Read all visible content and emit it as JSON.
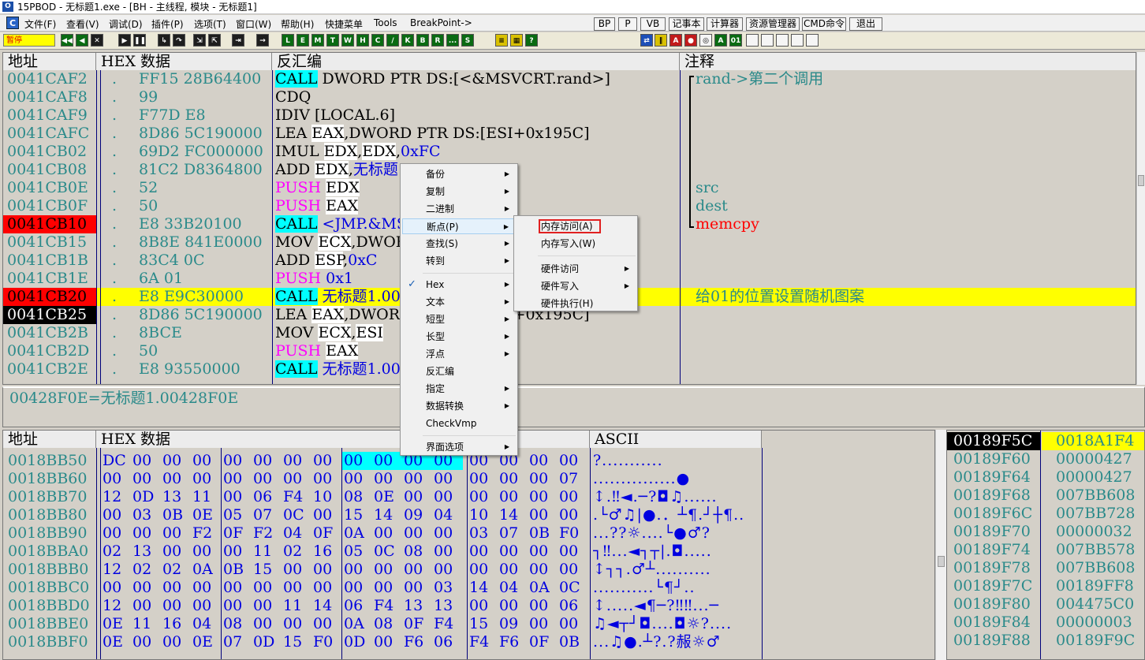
{
  "window": {
    "title": "15PBOD  - 无标题1.exe - [BH - 主线程, 模块 - 无标题1]"
  },
  "menu": [
    "文件(F)",
    "查看(V)",
    "调试(D)",
    "插件(P)",
    "选项(T)",
    "窗口(W)",
    "帮助(H)",
    "快捷菜单",
    "Tools",
    "BreakPoint->"
  ],
  "quick_buttons": [
    "BP",
    "P",
    "VB",
    "记事本",
    "计算器",
    "资源管理器",
    "CMD命令",
    "退出"
  ],
  "status_pause": "暂停",
  "toolbar_letters": [
    "L",
    "E",
    "M",
    "T",
    "W",
    "H",
    "C",
    "/",
    "K",
    "B",
    "R",
    "...",
    "S"
  ],
  "cpu": {
    "headers": {
      "addr": "地址",
      "hex": "HEX 数据",
      "dis": "反汇编",
      "cmt": "注释"
    },
    "rows": [
      {
        "addr": "0041CAF2",
        "mark": ".",
        "hex": "FF15 28B64400",
        "dis": [
          [
            "CALL",
            "cyan"
          ],
          [
            " DWORD PTR DS:[<&MSVCRT.rand>]",
            ""
          ]
        ],
        "cmt": [
          [
            "rand->第二个调用",
            "teal"
          ]
        ],
        "bracket": "top"
      },
      {
        "addr": "0041CAF8",
        "mark": ".",
        "hex": "99",
        "dis": [
          [
            "CDQ",
            ""
          ]
        ],
        "cmt": []
      },
      {
        "addr": "0041CAF9",
        "mark": ".",
        "hex": "F77D E8",
        "dis": [
          [
            "IDIV [LOCAL.6]",
            ""
          ]
        ],
        "cmt": []
      },
      {
        "addr": "0041CAFC",
        "mark": ".",
        "hex": "8D86 5C190000",
        "dis": [
          [
            "LEA ",
            ""
          ],
          [
            "EAX",
            "white"
          ],
          [
            ",DWORD PTR DS:[ESI+0x195C]",
            ""
          ]
        ],
        "cmt": []
      },
      {
        "addr": "0041CB02",
        "mark": ".",
        "hex": "69D2 FC000000",
        "dis": [
          [
            "IMUL ",
            ""
          ],
          [
            "EDX",
            "white"
          ],
          [
            ",",
            ""
          ],
          [
            "EDX",
            "white"
          ],
          [
            ",",
            ""
          ],
          [
            "0xFC",
            "blue"
          ]
        ],
        "cmt": []
      },
      {
        "addr": "0041CB08",
        "mark": ".",
        "hex": "81C2 D8364800",
        "dis": [
          [
            "ADD ",
            ""
          ],
          [
            "EDX",
            "white"
          ],
          [
            ",",
            ""
          ],
          [
            "无标题1.",
            "blue"
          ]
        ],
        "cmt": []
      },
      {
        "addr": "0041CB0E",
        "mark": ".",
        "hex": "52",
        "dis": [
          [
            "PUSH",
            "magenta"
          ],
          [
            " ",
            ""
          ],
          [
            "EDX",
            "white"
          ]
        ],
        "cmt": [
          [
            "src",
            "teal"
          ]
        ]
      },
      {
        "addr": "0041CB0F",
        "mark": ".",
        "hex": "50",
        "dis": [
          [
            "PUSH",
            "magenta"
          ],
          [
            " ",
            ""
          ],
          [
            "EAX",
            "white"
          ]
        ],
        "cmt": [
          [
            "dest",
            "teal"
          ]
        ]
      },
      {
        "addr": "0041CB10",
        "mark": ".",
        "hex": "E8 33B20100",
        "dis": [
          [
            "CALL",
            "cyan"
          ],
          [
            " <JMP.&MSVCRT.memcpy>",
            "blue"
          ]
        ],
        "cmt": [
          [
            "memcpy",
            "red"
          ]
        ],
        "addr_style": "red",
        "bracket": "bottom"
      },
      {
        "addr": "0041CB15",
        "mark": ".",
        "hex": "8B8E 841E0000",
        "dis": [
          [
            "MOV ",
            ""
          ],
          [
            "ECX",
            "white"
          ],
          [
            ",DWORD PTR DS:[ESI+0x1E84]",
            ""
          ]
        ],
        "cmt": []
      },
      {
        "addr": "0041CB1B",
        "mark": ".",
        "hex": "83C4 0C",
        "dis": [
          [
            "ADD ",
            ""
          ],
          [
            "ESP",
            "white"
          ],
          [
            ",",
            ""
          ],
          [
            "0xC",
            "blue"
          ]
        ],
        "cmt": []
      },
      {
        "addr": "0041CB1E",
        "mark": ".",
        "hex": "6A 01",
        "dis": [
          [
            "PUSH",
            "magenta"
          ],
          [
            " ",
            ""
          ],
          [
            "0x1",
            "blue"
          ]
        ],
        "cmt": []
      },
      {
        "addr": "0041CB20",
        "mark": ".",
        "hex": "E8 E9C30000",
        "dis": [
          [
            "CALL",
            "cyan"
          ],
          [
            " ",
            ""
          ],
          [
            "无标题1.0042",
            "blue"
          ]
        ],
        "cmt": [
          [
            "给01的位置设置随机图案",
            "teal"
          ]
        ],
        "addr_style": "red",
        "row_style": "yellow"
      },
      {
        "addr": "0041CB25",
        "mark": ".",
        "hex": "8D86 5C190000",
        "dis": [
          [
            "LEA ",
            ""
          ],
          [
            "EAX",
            "white"
          ],
          [
            ",DWORD PTR DS:[ESI+0x195C]",
            ""
          ]
        ],
        "cmt": [],
        "addr_style": "black"
      },
      {
        "addr": "0041CB2B",
        "mark": ".",
        "hex": "8BCE",
        "dis": [
          [
            "MOV ",
            ""
          ],
          [
            "ECX",
            "white"
          ],
          [
            ",",
            ""
          ],
          [
            "ESI",
            "white"
          ]
        ],
        "cmt": []
      },
      {
        "addr": "0041CB2D",
        "mark": ".",
        "hex": "50",
        "dis": [
          [
            "PUSH",
            "magenta"
          ],
          [
            " ",
            ""
          ],
          [
            "EAX",
            "white"
          ]
        ],
        "cmt": []
      },
      {
        "addr": "0041CB2E",
        "mark": ".",
        "hex": "E8 93550000",
        "dis": [
          [
            "CALL",
            "cyan"
          ],
          [
            " ",
            ""
          ],
          [
            "无标题1.0042",
            "blue"
          ]
        ],
        "cmt": []
      }
    ]
  },
  "info_line": "00428F0E=无标题1.00428F0E",
  "dump": {
    "headers": {
      "addr": "地址",
      "hex": "HEX 数据",
      "ascii": "ASCII"
    },
    "rows": [
      {
        "addr": "0018BB50",
        "bytes": [
          "DC",
          "00",
          "00",
          "00",
          "00",
          "00",
          "00",
          "00",
          "00",
          "00",
          "00",
          "00",
          "00",
          "00",
          "00",
          "00"
        ],
        "ascii": "?..........."
      },
      {
        "addr": "0018BB60",
        "bytes": [
          "00",
          "00",
          "00",
          "00",
          "00",
          "00",
          "00",
          "00",
          "00",
          "00",
          "00",
          "00",
          "00",
          "00",
          "00",
          "07"
        ],
        "ascii": "...............●"
      },
      {
        "addr": "0018BB70",
        "bytes": [
          "12",
          "0D",
          "13",
          "11",
          "00",
          "06",
          "F4",
          "10",
          "08",
          "0E",
          "00",
          "00",
          "00",
          "00",
          "00",
          "00"
        ],
        "ascii": "↕.‼◄.─?◘♫......"
      },
      {
        "addr": "0018BB80",
        "bytes": [
          "00",
          "03",
          "0B",
          "0E",
          "05",
          "07",
          "0C",
          "00",
          "15",
          "14",
          "09",
          "04",
          "10",
          "14",
          "00",
          "00"
        ],
        "ascii": ".└♂♫|●.．┴¶.┘┼¶.."
      },
      {
        "addr": "0018BB90",
        "bytes": [
          "00",
          "00",
          "00",
          "F2",
          "0F",
          "F2",
          "04",
          "0F",
          "0A",
          "00",
          "00",
          "00",
          "03",
          "07",
          "0B",
          "F0"
        ],
        "ascii": "...??☼....└●♂?"
      },
      {
        "addr": "0018BBA0",
        "bytes": [
          "02",
          "13",
          "00",
          "00",
          "00",
          "11",
          "02",
          "16",
          "05",
          "0C",
          "08",
          "00",
          "00",
          "00",
          "00",
          "00"
        ],
        "ascii": "┐‼...◄┐┬|.◘....."
      },
      {
        "addr": "0018BBB0",
        "bytes": [
          "12",
          "02",
          "02",
          "0A",
          "0B",
          "15",
          "00",
          "00",
          "00",
          "00",
          "00",
          "00",
          "00",
          "00",
          "00",
          "00"
        ],
        "ascii": "↕┐┐.♂┴.........."
      },
      {
        "addr": "0018BBC0",
        "bytes": [
          "00",
          "00",
          "00",
          "00",
          "00",
          "00",
          "00",
          "00",
          "00",
          "00",
          "00",
          "03",
          "14",
          "04",
          "0A",
          "0C"
        ],
        "ascii": "...........└¶┘.."
      },
      {
        "addr": "0018BBD0",
        "bytes": [
          "12",
          "00",
          "00",
          "00",
          "00",
          "00",
          "11",
          "14",
          "06",
          "F4",
          "13",
          "13",
          "00",
          "00",
          "00",
          "06"
        ],
        "ascii": "↕.....◄¶─?‼‼...─"
      },
      {
        "addr": "0018BBE0",
        "bytes": [
          "0E",
          "11",
          "16",
          "04",
          "08",
          "00",
          "00",
          "00",
          "0A",
          "08",
          "0F",
          "F4",
          "15",
          "09",
          "00",
          "00"
        ],
        "ascii": "♫◄┬┘◘....◘☼?...."
      },
      {
        "addr": "0018BBF0",
        "bytes": [
          "0E",
          "00",
          "00",
          "0E",
          "07",
          "0D",
          "15",
          "F0",
          "0D",
          "00",
          "F6",
          "06",
          "F4",
          "F6",
          "0F",
          "0B"
        ],
        "ascii": "...♫●.┴?.?赧☼♂"
      }
    ]
  },
  "stack": {
    "rows": [
      {
        "addr": "00189F5C",
        "val": "0018A1F4",
        "top": true
      },
      {
        "addr": "00189F60",
        "val": "00000427"
      },
      {
        "addr": "00189F64",
        "val": "00000427"
      },
      {
        "addr": "00189F68",
        "val": "007BB608"
      },
      {
        "addr": "00189F6C",
        "val": "007BB728"
      },
      {
        "addr": "00189F70",
        "val": "00000032"
      },
      {
        "addr": "00189F74",
        "val": "007BB578"
      },
      {
        "addr": "00189F78",
        "val": "007BB608"
      },
      {
        "addr": "00189F7C",
        "val": "00189FF8"
      },
      {
        "addr": "00189F80",
        "val": "004475C0"
      },
      {
        "addr": "00189F84",
        "val": "00000003"
      },
      {
        "addr": "00189F88",
        "val": "00189F9C"
      }
    ]
  },
  "context_menu": {
    "items": [
      {
        "label": "备份",
        "sub": true
      },
      {
        "label": "复制",
        "sub": true
      },
      {
        "label": "二进制",
        "sub": true
      },
      {
        "label": "断点(P)",
        "sub": true,
        "active": true
      },
      {
        "label": "查找(S)",
        "sub": true
      },
      {
        "label": "转到",
        "sub": true
      },
      {
        "sep": true
      },
      {
        "label": "Hex",
        "sub": true,
        "checked": true
      },
      {
        "label": "文本",
        "sub": true
      },
      {
        "label": "短型",
        "sub": true
      },
      {
        "label": "长型",
        "sub": true
      },
      {
        "label": "浮点",
        "sub": true
      },
      {
        "label": "反汇编",
        "sub": false
      },
      {
        "label": "指定",
        "sub": true
      },
      {
        "label": "数据转换",
        "sub": true
      },
      {
        "label": "CheckVmp",
        "sub": false
      },
      {
        "sep": true
      },
      {
        "label": "界面选项",
        "sub": true
      }
    ],
    "submenu": [
      {
        "label": "内存访问(A)",
        "boxed": true
      },
      {
        "label": "内存写入(W)"
      },
      {
        "sep": true
      },
      {
        "label": "硬件访问",
        "sub": true
      },
      {
        "label": "硬件写入",
        "sub": true
      },
      {
        "label": "硬件执行(H)"
      }
    ]
  },
  "colors": {
    "cyan": "#00ffff",
    "yellow": "#ffff00",
    "red": "#ff0000",
    "teal": "#2a8a8a",
    "blue": "#0000e0",
    "magenta": "#ff00ff"
  }
}
